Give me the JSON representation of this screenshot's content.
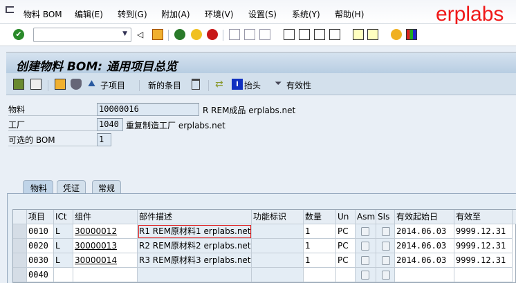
{
  "menu": [
    "物料 BOM",
    "编辑(E)",
    "转到(G)",
    "附加(A)",
    "环境(V)",
    "设置(S)",
    "系统(Y)",
    "帮助(H)"
  ],
  "logo": "erplabs",
  "command_field": {
    "value": ""
  },
  "title": "创建物料 BOM: 通用项目总览",
  "app_toolbar": {
    "subitem": "子项目",
    "new_items": "新的条目",
    "header": "抬头",
    "validity": "有效性"
  },
  "header_fields": {
    "material": {
      "label": "物料",
      "value": "10000016",
      "desc": "R REM成品 erplabs.net"
    },
    "plant": {
      "label": "工厂",
      "value": "1040",
      "desc": "重复制造工厂 erplabs.net"
    },
    "alt_bom": {
      "label": "可选的 BOM",
      "value": "1"
    }
  },
  "tabs": [
    "物料",
    "凭证",
    "常规"
  ],
  "table": {
    "columns": [
      "项目",
      "ICt",
      "组件",
      "部件描述",
      "功能标识",
      "数量",
      "Un",
      "Asm",
      "SIs",
      "有效起始日",
      "有效至"
    ],
    "rows": [
      [
        "0010",
        "L",
        "30000012",
        "R1 REM原材料1 erplabs.net",
        "",
        "1",
        "PC",
        "",
        "",
        "2014.06.03",
        "9999.12.31"
      ],
      [
        "0020",
        "L",
        "30000013",
        "R2 REM原材料2 erplabs.net",
        "",
        "1",
        "PC",
        "",
        "",
        "2014.06.03",
        "9999.12.31"
      ],
      [
        "0030",
        "L",
        "30000014",
        "R3 REM原材料3 erplabs.net",
        "",
        "1",
        "PC",
        "",
        "",
        "2014.06.03",
        "9999.12.31"
      ],
      [
        "0040",
        "",
        "",
        "",
        "",
        "",
        "",
        "",
        "",
        "",
        ""
      ]
    ]
  }
}
